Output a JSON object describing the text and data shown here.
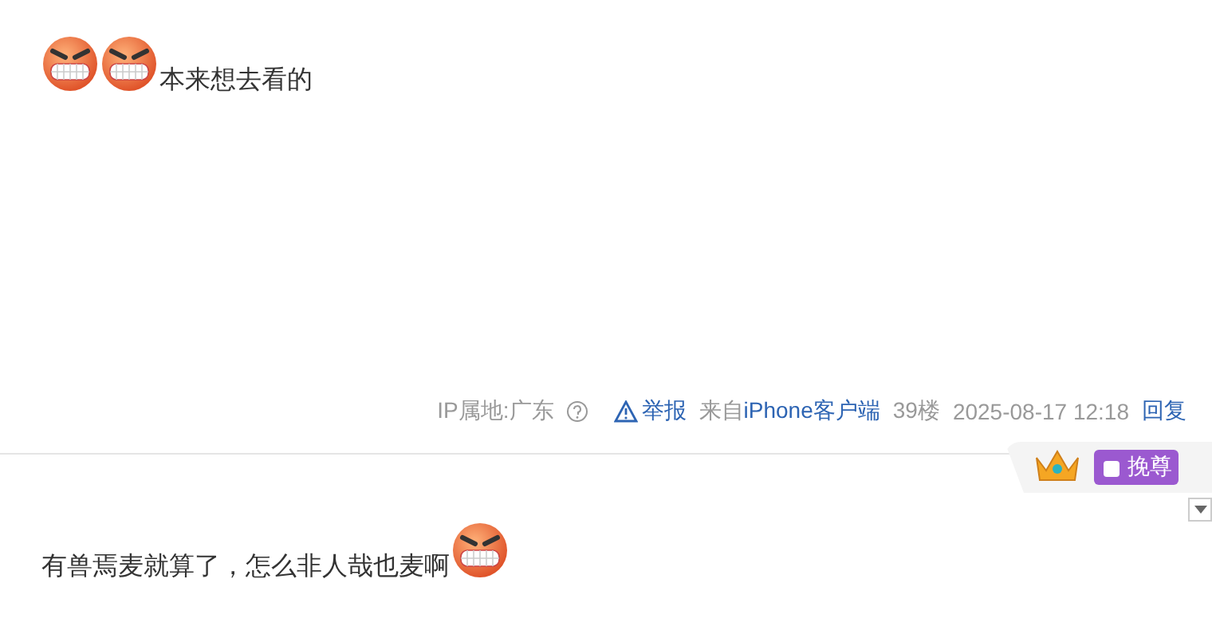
{
  "posts": [
    {
      "content": [
        {
          "kind": "emoticon"
        },
        {
          "kind": "emoticon"
        },
        {
          "kind": "text",
          "text": "本来想去看的"
        }
      ],
      "footer": {
        "ip": "IP属地:广东",
        "report": "举报",
        "source_prefix": "来自",
        "source_link": "iPhone客户端",
        "floor": "39楼",
        "time": "2025-08-17 12:18",
        "reply": "回复"
      }
    },
    {
      "badge": {
        "label": "挽尊"
      },
      "content": [
        {
          "kind": "text",
          "text": "有兽焉麦就算了，怎么非人哉也麦啊"
        },
        {
          "kind": "emoticon"
        }
      ]
    }
  ]
}
